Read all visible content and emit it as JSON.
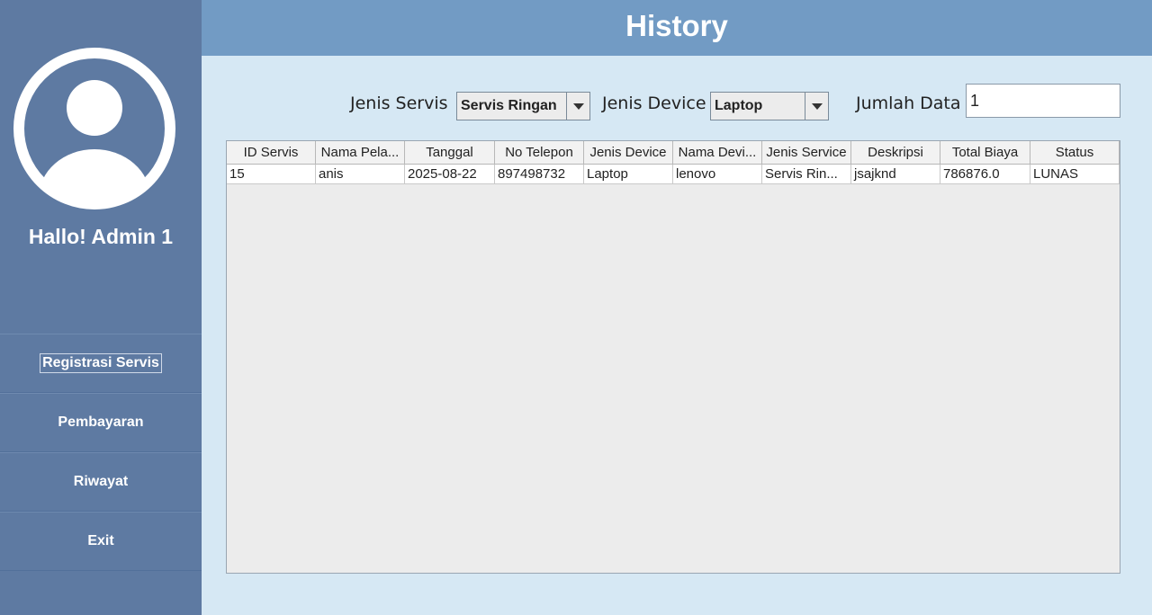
{
  "header": {
    "title": "History"
  },
  "sidebar": {
    "greeting": "Hallo! Admin 1",
    "items": [
      {
        "label": "Registrasi Servis"
      },
      {
        "label": "Pembayaran"
      },
      {
        "label": "Riwayat"
      },
      {
        "label": "Exit"
      }
    ]
  },
  "filters": {
    "jenis_servis_label": "Jenis Servis",
    "jenis_servis_value": "Servis Ringan",
    "jenis_device_label": "Jenis Device",
    "jenis_device_value": "Laptop",
    "jumlah_data_label": "Jumlah Data",
    "jumlah_data_value": "1"
  },
  "table": {
    "columns": [
      "ID Servis",
      "Nama Pela...",
      "Tanggal",
      "No Telepon",
      "Jenis Device",
      "Nama Devi...",
      "Jenis Service",
      "Deskripsi",
      "Total Biaya",
      "Status"
    ],
    "rows": [
      [
        "15",
        "anis",
        "2025-08-22",
        "897498732",
        "Laptop",
        "lenovo",
        "Servis Rin...",
        "jsajknd",
        "786876.0",
        "LUNAS"
      ]
    ]
  },
  "colors": {
    "sidebar": "#5e7aa2",
    "header": "#729bc4",
    "content": "#d6e8f4"
  },
  "icons": {
    "avatar": "user-avatar-icon",
    "dropdown": "chevron-down-icon"
  }
}
